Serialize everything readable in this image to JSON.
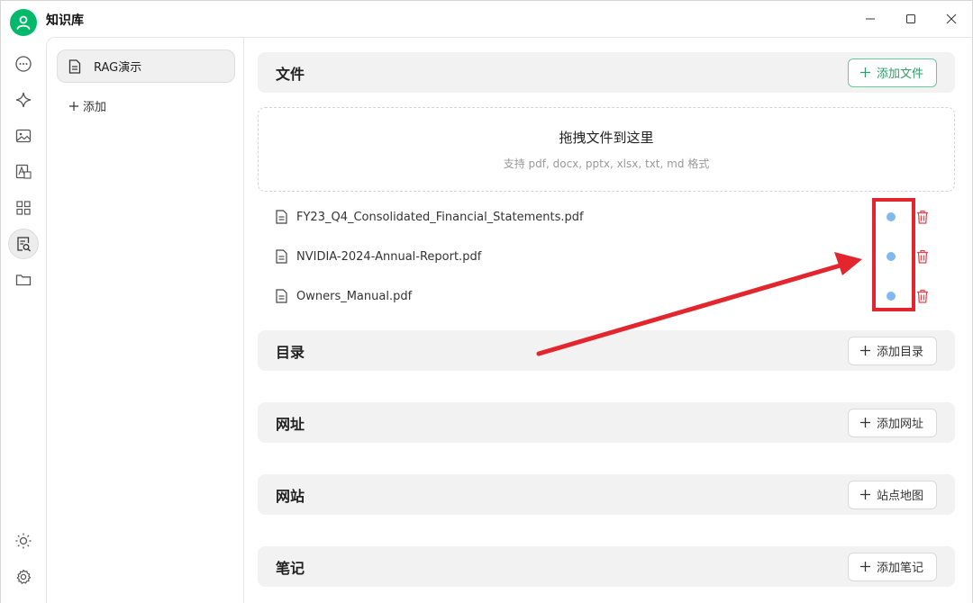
{
  "app": {
    "title": "知识库"
  },
  "knowledge_bases": {
    "items": [
      {
        "label": "RAG演示",
        "icon": "document-icon"
      }
    ],
    "add_label": "添加"
  },
  "rail": {
    "items": [
      "chat-icon",
      "sparkle-icon",
      "image-icon",
      "translate-icon",
      "apps-icon",
      "knowledge-icon",
      "folder-icon"
    ],
    "bottom": [
      "theme-icon",
      "settings-icon"
    ],
    "active": "knowledge-icon"
  },
  "files": {
    "title": "文件",
    "add_label": "添加文件",
    "dropzone_title": "拖拽文件到这里",
    "dropzone_hint": "支持 pdf, docx, pptx, xlsx, txt, md 格式",
    "items": [
      {
        "name": "FY23_Q4_Consolidated_Financial_Statements.pdf"
      },
      {
        "name": "NVIDIA-2024-Annual-Report.pdf"
      },
      {
        "name": "Owners_Manual.pdf"
      }
    ]
  },
  "directory": {
    "title": "目录",
    "add_label": "添加目录"
  },
  "urls": {
    "title": "网址",
    "add_label": "添加网址"
  },
  "sites": {
    "title": "网站",
    "add_label": "站点地图"
  },
  "notes": {
    "title": "笔记",
    "add_label": "添加笔记"
  },
  "colors": {
    "accent": "#00b96b",
    "status_dot": "#7fb9f0",
    "delete": "#e8454d",
    "annotation": "#e3262e"
  }
}
